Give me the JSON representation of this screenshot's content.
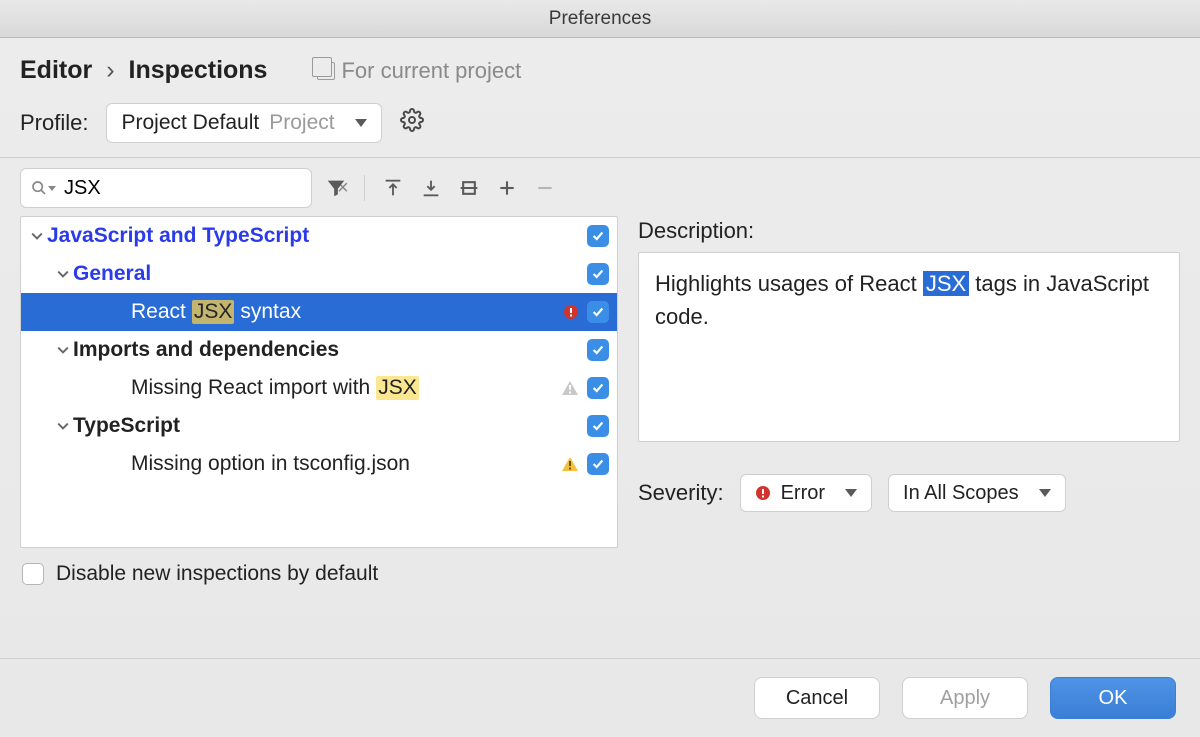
{
  "title": "Preferences",
  "breadcrumb": {
    "a": "Editor",
    "b": "Inspections"
  },
  "scope": "For current project",
  "profile": {
    "label": "Profile:",
    "value": "Project Default",
    "secondary": "Project"
  },
  "search": {
    "value": "JSX"
  },
  "tree": {
    "root": "JavaScript and TypeScript",
    "groups": [
      {
        "name": "General",
        "items": [
          {
            "before": "React ",
            "hl": "JSX",
            "after": " syntax",
            "status": "error",
            "selected": true
          }
        ]
      },
      {
        "name": "Imports and dependencies",
        "darkHeader": true,
        "items": [
          {
            "before": "Missing React import with ",
            "hl": "JSX",
            "after": "",
            "status": "warn-grey"
          }
        ]
      },
      {
        "name": "TypeScript",
        "darkHeader": true,
        "items": [
          {
            "before": "Missing option in tsconfig.json",
            "hl": "",
            "after": "",
            "status": "warn-yellow"
          }
        ]
      }
    ]
  },
  "disableLabel": "Disable new inspections by default",
  "right": {
    "descLabel": "Description:",
    "descBefore": "Highlights usages of React ",
    "descJSX": "JSX",
    "descAfter": " tags in JavaScript code.",
    "sevLabel": "Severity:",
    "sevValue": "Error",
    "scopeValue": "In All Scopes"
  },
  "buttons": {
    "cancel": "Cancel",
    "apply": "Apply",
    "ok": "OK"
  }
}
